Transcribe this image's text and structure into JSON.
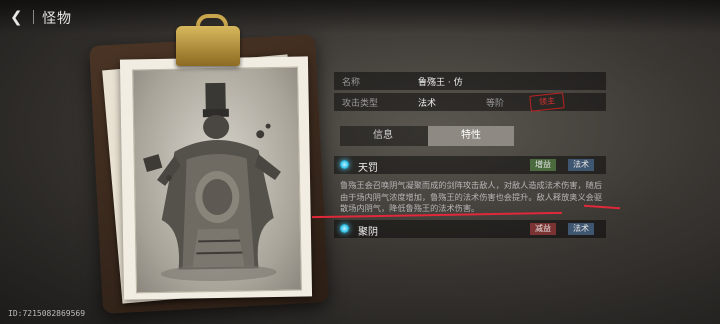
{
  "header": {
    "back_icon": "back-arrow-icon",
    "title": "怪物"
  },
  "footer": {
    "id_text": "ID:7215082869569"
  },
  "info": {
    "name_label": "名称",
    "name_value": "鲁殇王 · 仿",
    "attack_type_label": "攻击类型",
    "attack_type_value": "法术",
    "rank_label": "等阶",
    "rank_stamp": "领主"
  },
  "tabs": [
    {
      "label": "信息",
      "active": false
    },
    {
      "label": "特性",
      "active": true
    }
  ],
  "skills": [
    {
      "name": "天罚",
      "tags": [
        {
          "label": "增益",
          "kind": "buff"
        },
        {
          "label": "法术",
          "kind": "magic"
        }
      ],
      "description": "鲁殇王会召唤阴气凝聚而成的剑阵攻击敌人，对敌人造成法术伤害，随后由于场内阴气浓度增加，鲁殇王的法术伤害也会提升。敌人释放奥义会驱散场内阴气，降低鲁殇王的法术伤害。"
    },
    {
      "name": "聚阴",
      "tags": [
        {
          "label": "减益",
          "kind": "debuff"
        },
        {
          "label": "法术",
          "kind": "magic"
        }
      ]
    }
  ],
  "colors": {
    "accent_orb": "#34c3ea",
    "annotation_red": "#e0283a",
    "buff": "#4b6b3f",
    "debuff": "#7a3232",
    "magic": "#3f5670"
  }
}
